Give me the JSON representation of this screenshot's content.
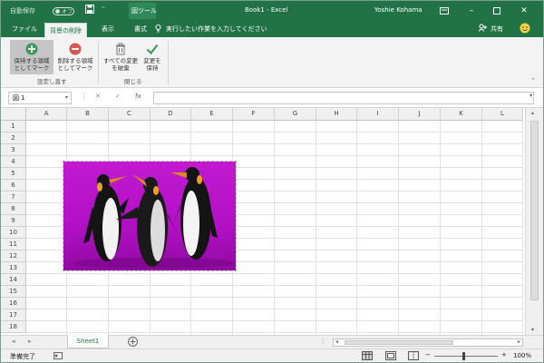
{
  "titlebar": {
    "autosave_label": "自動保存",
    "autosave_state": "オフ",
    "context_tool": "図ツール",
    "doc_title": "Book1 - Excel",
    "user": "Yoshie Kohama"
  },
  "tabs": [
    "ファイル",
    "背景の削除",
    "表示",
    "書式"
  ],
  "tellme": "実行したい作業を入力してください",
  "share": "共有",
  "ribbon": {
    "buttons": [
      {
        "line1": "保持する領域",
        "line2": "としてマーク",
        "icon": "plus-circle-icon"
      },
      {
        "line1": "削除する領域",
        "line2": "としてマーク",
        "icon": "minus-circle-icon"
      },
      {
        "line1": "すべての変更",
        "line2": "を破棄",
        "icon": "discard-icon"
      },
      {
        "line1": "変更を",
        "line2": "保持",
        "icon": "checkmark-icon"
      }
    ],
    "groups": [
      "設定し直す",
      "閉じる"
    ]
  },
  "formula": {
    "namebox": "図 1",
    "cancel": "✕",
    "enter": "✓",
    "fx": "fx"
  },
  "grid": {
    "columns": [
      "A",
      "B",
      "C",
      "D",
      "E",
      "F",
      "G",
      "H",
      "I",
      "J",
      "K",
      "L"
    ],
    "rows": [
      "1",
      "2",
      "3",
      "4",
      "5",
      "6",
      "7",
      "8",
      "9",
      "10",
      "11",
      "12",
      "13",
      "14",
      "15",
      "16",
      "17",
      "18"
    ]
  },
  "sheets": [
    "Sheet1"
  ],
  "status": {
    "ready": "準備完了",
    "zoom": "100%"
  },
  "colors": {
    "accent": "#217346",
    "picture_bg": "#b20fc4"
  }
}
